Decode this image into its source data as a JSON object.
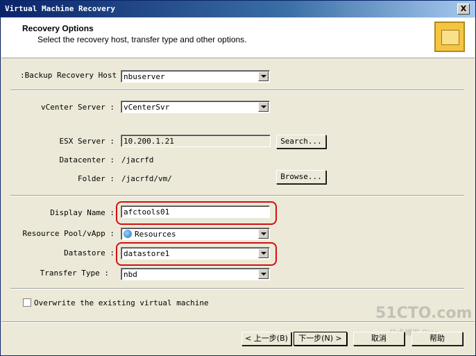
{
  "window": {
    "title": "Virtual Machine Recovery",
    "close_label": "X"
  },
  "header": {
    "title": "Recovery Options",
    "subtitle": "Select the recovery host, transfer type and other options."
  },
  "form": {
    "backup_host": {
      "label": ":Backup Recovery Host",
      "value": "nbuserver"
    },
    "vcenter": {
      "label": "vCenter Server :",
      "value": "vCenterSvr"
    },
    "esx": {
      "label": "ESX Server :",
      "value": "10.200.1.21"
    },
    "search_button": "Search...",
    "datacenter": {
      "label": "Datacenter :",
      "value": "/jacrfd"
    },
    "folder": {
      "label": "Folder :",
      "value": "/jacrfd/vm/"
    },
    "browse_button": "Browse...",
    "display_name": {
      "label": "Display Name :",
      "value": "afctools01"
    },
    "resource_pool": {
      "label": "Resource Pool/vApp :",
      "value": "Resources"
    },
    "datastore": {
      "label": "Datastore :",
      "value": "datastore1"
    },
    "transfer_type": {
      "label": "Transfer Type :",
      "value": "nbd"
    },
    "overwrite": {
      "label": "Overwrite the existing virtual machine",
      "checked": false
    }
  },
  "buttons": {
    "back": "< 上一步(B)",
    "next": "下一步(N) >",
    "cancel": "取消",
    "help": "帮助"
  },
  "watermark": {
    "line1": "51CTO.com",
    "line2": "技术博客 Blog"
  },
  "colors": {
    "highlight_ring": "#d01010",
    "title_bar": "#0a246a"
  }
}
